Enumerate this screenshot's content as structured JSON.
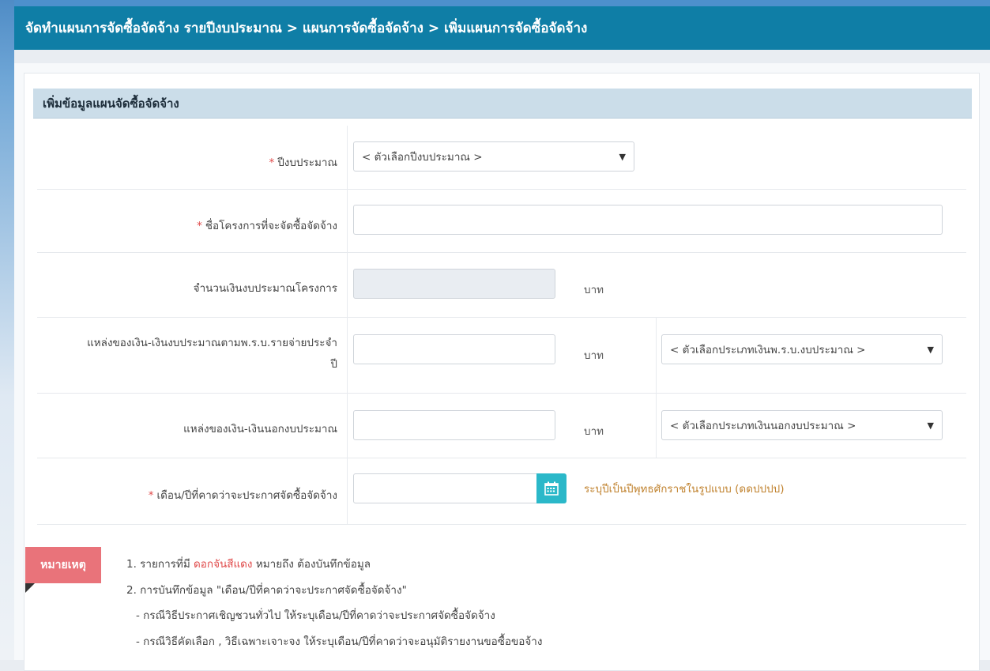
{
  "breadcrumb": "จัดทำแผนการจัดซื้อจัดจ้าง รายปีงบประมาณ > แผนการจัดซื้อจัดจ้าง > เพิ่มแผนการจัดซื้อจัดจ้าง",
  "panel": {
    "heading": "เพิ่มข้อมูลแผนจัดซื้อจัดจ้าง"
  },
  "form": {
    "required_mark": "*",
    "fiscal_year": {
      "label": "ปีงบประมาณ",
      "placeholder": "< ตัวเลือกปีงบประมาณ >"
    },
    "project_name": {
      "label": "ชื่อโครงการที่จะจัดซื้อจัดจ้าง",
      "value": ""
    },
    "budget_amount": {
      "label": "จำนวนเงินงบประมาณโครงการ",
      "unit": "บาท",
      "value": ""
    },
    "annual_budget_source": {
      "label_line1": "แหล่งของเงิน-เงินงบประมาณตามพ.ร.บ.รายจ่ายประจำ",
      "label_line2": "ปี",
      "unit": "บาท",
      "select_placeholder": "< ตัวเลือกประเภทเงินพ.ร.บ.งบประมาณ >"
    },
    "non_budget_source": {
      "label": "แหล่งของเงิน-เงินนอกงบประมาณ",
      "unit": "บาท",
      "select_placeholder": "< ตัวเลือกประเภทเงินนอกงบประมาณ >"
    },
    "announce_month": {
      "label": "เดือน/ปีที่คาดว่าจะประกาศจัดซื้อจัดจ้าง",
      "hint": "ระบุปีเป็นปีพุทธศักราชในรูปแบบ (ดดปปปป)",
      "icon": "calendar-icon"
    }
  },
  "note": {
    "tag": "หมายเหตุ",
    "line1_prefix": "1. รายการที่มี",
    "line1_highlight": "ดอกจันสีแดง",
    "line1_suffix": "หมายถึง ต้องบันทึกข้อมูล",
    "line2": "2. การบันทึกข้อมูล \"เดือน/ปีที่คาดว่าจะประกาศจัดซื้อจัดจ้าง\"",
    "line3": "- กรณีวิธีประกาศเชิญชวนทั่วไป ให้ระบุเดือน/ปีที่คาดว่าจะประกาศจัดซื้อจัดจ้าง",
    "line4": "- กรณีวิธีคัดเลือก , วิธีเฉพาะเจาะจง ให้ระบุเดือน/ปีที่คาดว่าจะอนุมัติรายงานขอซื้อขอจ้าง"
  },
  "colors": {
    "header": "#0f7ea6",
    "panel_heading": "#cbdde9",
    "required": "#e04a4a",
    "hint": "#c0822e",
    "calendar_button": "#2bb8c9",
    "note_tag": "#e9737a"
  }
}
